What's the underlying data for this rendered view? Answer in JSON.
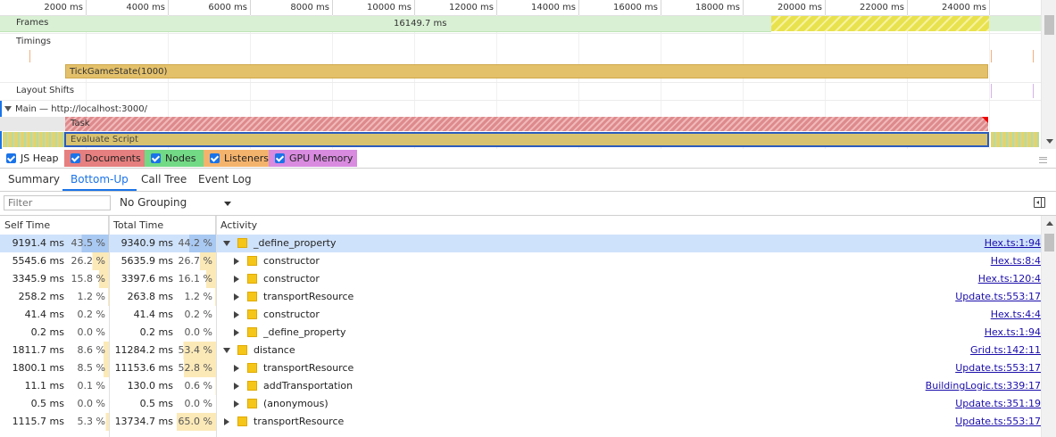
{
  "ruler": {
    "ticks": [
      "2000 ms",
      "4000 ms",
      "6000 ms",
      "8000 ms",
      "10000 ms",
      "12000 ms",
      "14000 ms",
      "16000 ms",
      "18000 ms",
      "20000 ms",
      "22000 ms",
      "24000 ms"
    ]
  },
  "tracks": {
    "frames_label": "Frames",
    "frames_duration": "16149.7 ms",
    "timings_label": "Timings",
    "tick_game_state": "TickGameState(1000)",
    "layout_shifts_label": "Layout Shifts",
    "main_label": "Main — http://localhost:3000/",
    "task_label": "Task",
    "evaluate_script_label": "Evaluate Script"
  },
  "memory": {
    "items": [
      {
        "label": "JS Heap",
        "checked": true,
        "color": "#ffffff"
      },
      {
        "label": "Documents",
        "checked": true,
        "color": "#e67f7f"
      },
      {
        "label": "Nodes",
        "checked": true,
        "color": "#72d985"
      },
      {
        "label": "Listeners",
        "checked": true,
        "color": "#f4b36c"
      },
      {
        "label": "GPU Memory",
        "checked": true,
        "color": "#d98be0"
      }
    ]
  },
  "tabs": [
    {
      "label": "Summary",
      "active": false
    },
    {
      "label": "Bottom-Up",
      "active": true
    },
    {
      "label": "Call Tree",
      "active": false
    },
    {
      "label": "Event Log",
      "active": false
    }
  ],
  "toolbar": {
    "filter_placeholder": "Filter",
    "grouping": "No Grouping"
  },
  "table": {
    "headers": {
      "self": "Self Time",
      "total": "Total Time",
      "activity": "Activity"
    },
    "rows": [
      {
        "self_ms": "9191.4 ms",
        "self_pct": "43.5 %",
        "self_frac": 0.435,
        "total_ms": "9340.9 ms",
        "total_pct": "44.2 %",
        "total_frac": 0.442,
        "level": 0,
        "expanded": true,
        "name": "_define_property",
        "url": "Hex.ts:1:94",
        "selected": true
      },
      {
        "self_ms": "5545.6 ms",
        "self_pct": "26.2 %",
        "self_frac": 0.262,
        "total_ms": "5635.9 ms",
        "total_pct": "26.7 %",
        "total_frac": 0.267,
        "level": 1,
        "expanded": false,
        "name": "constructor",
        "url": "Hex.ts:8:4",
        "selected": false
      },
      {
        "self_ms": "3345.9 ms",
        "self_pct": "15.8 %",
        "self_frac": 0.158,
        "total_ms": "3397.6 ms",
        "total_pct": "16.1 %",
        "total_frac": 0.161,
        "level": 1,
        "expanded": false,
        "name": "constructor",
        "url": "Hex.ts:120:4",
        "selected": false
      },
      {
        "self_ms": "258.2 ms",
        "self_pct": "1.2 %",
        "self_frac": 0.012,
        "total_ms": "263.8 ms",
        "total_pct": "1.2 %",
        "total_frac": 0.012,
        "level": 1,
        "expanded": false,
        "name": "transportResource",
        "url": "Update.ts:553:17",
        "selected": false
      },
      {
        "self_ms": "41.4 ms",
        "self_pct": "0.2 %",
        "self_frac": 0.002,
        "total_ms": "41.4 ms",
        "total_pct": "0.2 %",
        "total_frac": 0.002,
        "level": 1,
        "expanded": false,
        "name": "constructor",
        "url": "Hex.ts:4:4",
        "selected": false
      },
      {
        "self_ms": "0.2 ms",
        "self_pct": "0.0 %",
        "self_frac": 0.0,
        "total_ms": "0.2 ms",
        "total_pct": "0.0 %",
        "total_frac": 0.0,
        "level": 1,
        "expanded": false,
        "name": "_define_property",
        "url": "Hex.ts:1:94",
        "selected": false
      },
      {
        "self_ms": "1811.7 ms",
        "self_pct": "8.6 %",
        "self_frac": 0.086,
        "total_ms": "11284.2 ms",
        "total_pct": "53.4 %",
        "total_frac": 0.534,
        "level": 0,
        "expanded": true,
        "name": "distance",
        "url": "Grid.ts:142:11",
        "selected": false
      },
      {
        "self_ms": "1800.1 ms",
        "self_pct": "8.5 %",
        "self_frac": 0.085,
        "total_ms": "11153.6 ms",
        "total_pct": "52.8 %",
        "total_frac": 0.528,
        "level": 1,
        "expanded": false,
        "name": "transportResource",
        "url": "Update.ts:553:17",
        "selected": false
      },
      {
        "self_ms": "11.1 ms",
        "self_pct": "0.1 %",
        "self_frac": 0.001,
        "total_ms": "130.0 ms",
        "total_pct": "0.6 %",
        "total_frac": 0.006,
        "level": 1,
        "expanded": false,
        "name": "addTransportation",
        "url": "BuildingLogic.ts:339:17",
        "selected": false
      },
      {
        "self_ms": "0.5 ms",
        "self_pct": "0.0 %",
        "self_frac": 0.0,
        "total_ms": "0.5 ms",
        "total_pct": "0.0 %",
        "total_frac": 0.0,
        "level": 1,
        "expanded": false,
        "name": "(anonymous)",
        "url": "Update.ts:351:19",
        "selected": false
      },
      {
        "self_ms": "1115.7 ms",
        "self_pct": "5.3 %",
        "self_frac": 0.053,
        "total_ms": "13734.7 ms",
        "total_pct": "65.0 %",
        "total_frac": 0.65,
        "level": 0,
        "expanded": false,
        "name": "transportResource",
        "url": "Update.ts:553:17",
        "selected": false
      }
    ]
  }
}
